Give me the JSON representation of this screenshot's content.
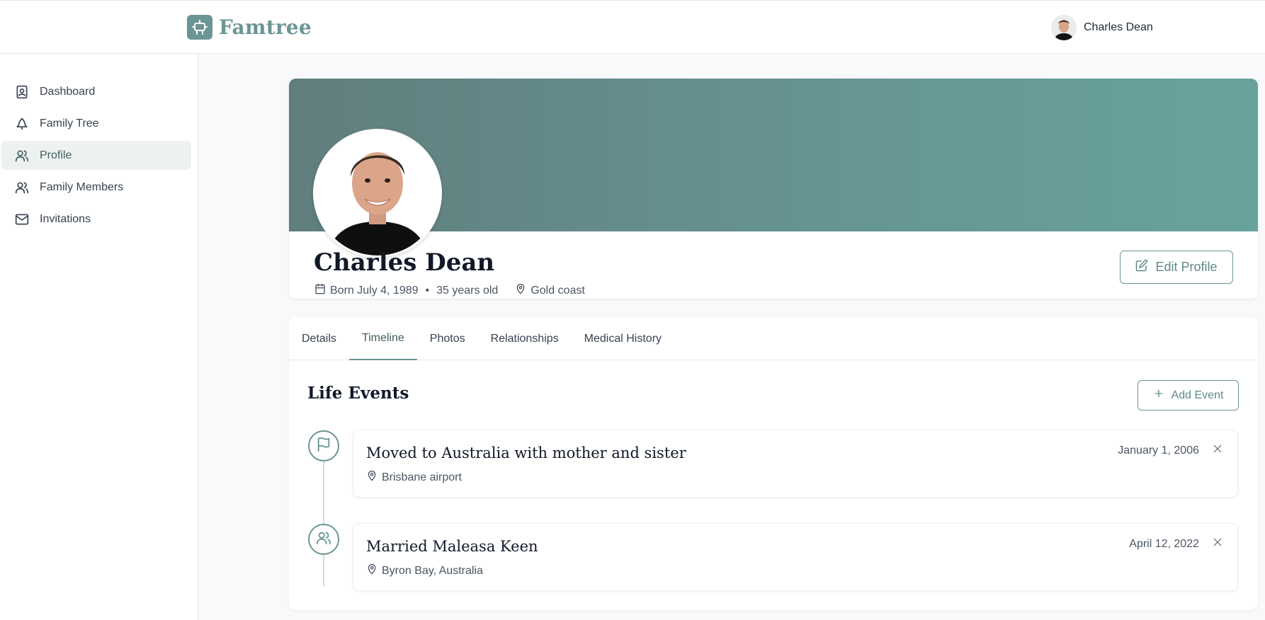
{
  "app": {
    "name": "Famtree"
  },
  "header": {
    "user_name": "Charles Dean"
  },
  "sidebar": {
    "items": [
      {
        "label": "Dashboard",
        "icon": "contact-book-icon"
      },
      {
        "label": "Family Tree",
        "icon": "tree-icon"
      },
      {
        "label": "Profile",
        "icon": "users-icon",
        "active": true
      },
      {
        "label": "Family Members",
        "icon": "users-icon"
      },
      {
        "label": "Invitations",
        "icon": "mail-icon"
      }
    ]
  },
  "profile": {
    "name": "Charles Dean",
    "born": "Born July 4, 1989",
    "separator": "•",
    "age": "35 years old",
    "location": "Gold coast",
    "edit_label": "Edit Profile"
  },
  "tabs": [
    {
      "label": "Details"
    },
    {
      "label": "Timeline",
      "active": true
    },
    {
      "label": "Photos"
    },
    {
      "label": "Relationships"
    },
    {
      "label": "Medical History"
    }
  ],
  "timeline": {
    "title": "Life Events",
    "add_label": "Add Event",
    "events": [
      {
        "title": "Moved to Australia with mother and sister",
        "location": "Brisbane airport",
        "date": "January 1, 2006",
        "icon": "flag-icon"
      },
      {
        "title": "Married Maleasa Keen",
        "location": "Byron Bay, Australia",
        "date": "April 12, 2022",
        "icon": "users-icon"
      }
    ]
  },
  "colors": {
    "accent": "#6b9594",
    "cover_start": "#617e7e",
    "cover_end": "#68a29d",
    "active_nav_bg": "#edf2f1"
  }
}
